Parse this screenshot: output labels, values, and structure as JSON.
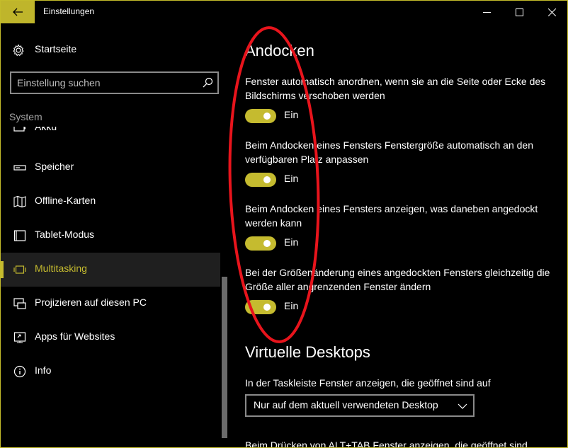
{
  "window": {
    "title": "Einstellungen"
  },
  "sidebar": {
    "home_label": "Startseite",
    "search_placeholder": "Einstellung suchen",
    "group_label": "System",
    "items": [
      {
        "label": "Akku",
        "icon": "battery-icon"
      },
      {
        "label": "Speicher",
        "icon": "storage-icon"
      },
      {
        "label": "Offline-Karten",
        "icon": "map-icon"
      },
      {
        "label": "Tablet-Modus",
        "icon": "tablet-icon"
      },
      {
        "label": "Multitasking",
        "icon": "multitasking-icon",
        "selected": true
      },
      {
        "label": "Projizieren auf diesen PC",
        "icon": "project-icon"
      },
      {
        "label": "Apps für Websites",
        "icon": "apps-websites-icon"
      },
      {
        "label": "Info",
        "icon": "info-icon"
      }
    ]
  },
  "main": {
    "snap": {
      "title": "Andocken",
      "options": [
        {
          "text": "Fenster automatisch anordnen, wenn sie an die Seite oder Ecke des Bildschirms verschoben werden",
          "state": "Ein"
        },
        {
          "text": "Beim Andocken eines Fensters Fenstergröße automatisch an den verfügbaren Platz anpassen",
          "state": "Ein"
        },
        {
          "text": "Beim Andocken eines Fensters anzeigen, was daneben angedockt werden kann",
          "state": "Ein"
        },
        {
          "text": "Bei der Größenänderung eines angedockten Fensters gleichzeitig die Größe aller angrenzenden Fenster ändern",
          "state": "Ein"
        }
      ]
    },
    "virtual_desktops": {
      "title": "Virtuelle Desktops",
      "taskbar_label": "In der Taskleiste Fenster anzeigen, die geöffnet sind auf",
      "taskbar_value": "Nur auf dem aktuell verwendeten Desktop",
      "alttab_label": "Beim Drücken von ALT+TAB Fenster anzeigen, die geöffnet sind"
    }
  },
  "colors": {
    "accent": "#c5bb2f",
    "annotation": "#e8141c"
  }
}
